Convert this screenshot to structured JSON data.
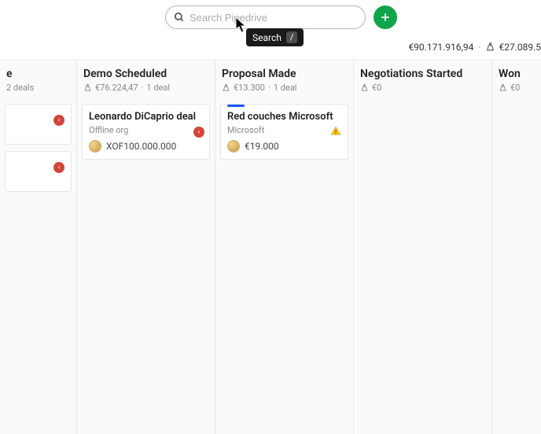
{
  "header": {
    "search_placeholder": "Search Pipedrive",
    "tooltip_label": "Search",
    "tooltip_key": "/"
  },
  "summary": {
    "total": "€90.171.916,94",
    "weighted": "€27.089.5"
  },
  "columns": [
    {
      "title": "e",
      "sub": "2 deals",
      "amount": "",
      "partial": "left",
      "cards": [
        {
          "stub": true,
          "status": "red",
          "accent": false
        },
        {
          "stub": true,
          "status": "red",
          "accent": false
        }
      ]
    },
    {
      "title": "Demo Scheduled",
      "amount": "€76.224,47",
      "sub": "1 deal",
      "cards": [
        {
          "title": "Leonardo DiCaprio deal",
          "org": "Offline org",
          "value": "XOF100.000.000",
          "status": "red",
          "accent": false
        }
      ]
    },
    {
      "title": "Proposal Made",
      "amount": "€13.300",
      "sub": "1 deal",
      "cards": [
        {
          "title": "Red couches Microsoft",
          "org": "Microsoft",
          "value": "€19.000",
          "status": "warn",
          "accent": true
        }
      ]
    },
    {
      "title": "Negotiations Started",
      "amount": "€0",
      "sub": "",
      "cards": []
    },
    {
      "title": "Won",
      "amount": "€0",
      "sub": "",
      "partial": "right",
      "cards": []
    }
  ]
}
